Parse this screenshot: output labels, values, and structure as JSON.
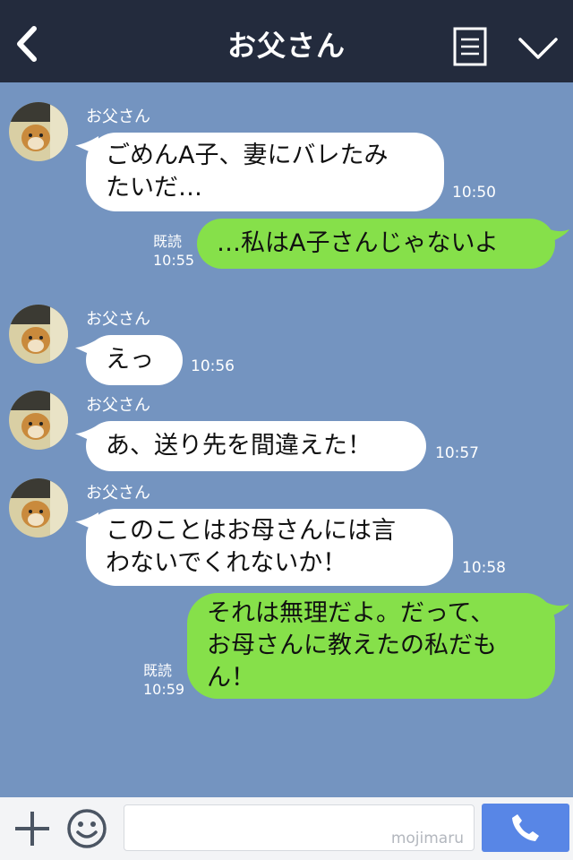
{
  "header": {
    "title": "お父さん",
    "back_icon": "chevron-left-icon",
    "notes_icon": "notes-icon",
    "menu_icon": "chevron-down-icon"
  },
  "messages": [
    {
      "sender": "お父さん",
      "lines": [
        "ごめんA子、妻にバレたみ",
        "たいだ…"
      ],
      "time": "10:50",
      "direction": "in"
    },
    {
      "lines": [
        "…私はA子さんじゃないよ"
      ],
      "time": "10:55",
      "read": "既読",
      "direction": "out"
    },
    {
      "sender": "お父さん",
      "lines": [
        "えっ"
      ],
      "time": "10:56",
      "direction": "in"
    },
    {
      "sender": "お父さん",
      "lines": [
        "あ、送り先を間違えた！"
      ],
      "time": "10:57",
      "direction": "in"
    },
    {
      "sender": "お父さん",
      "lines": [
        "このことはお母さんには言",
        "わないでくれないか！"
      ],
      "time": "10:58",
      "direction": "in"
    },
    {
      "lines": [
        "それは無理だよ。だって、",
        "お母さんに教えたの私だも",
        "ん！"
      ],
      "time": "10:59",
      "read": "既読",
      "direction": "out"
    }
  ],
  "input": {
    "value": "",
    "watermark": "mojimaru"
  },
  "bottom_icons": [
    "plus-icon",
    "emoji-icon",
    "phone-icon"
  ],
  "colors": {
    "header_bg": "#232b3d",
    "chat_bg": "#7494c0",
    "incoming_bubble": "#ffffff",
    "outgoing_bubble": "#86e04a",
    "call_button": "#5886e6"
  }
}
